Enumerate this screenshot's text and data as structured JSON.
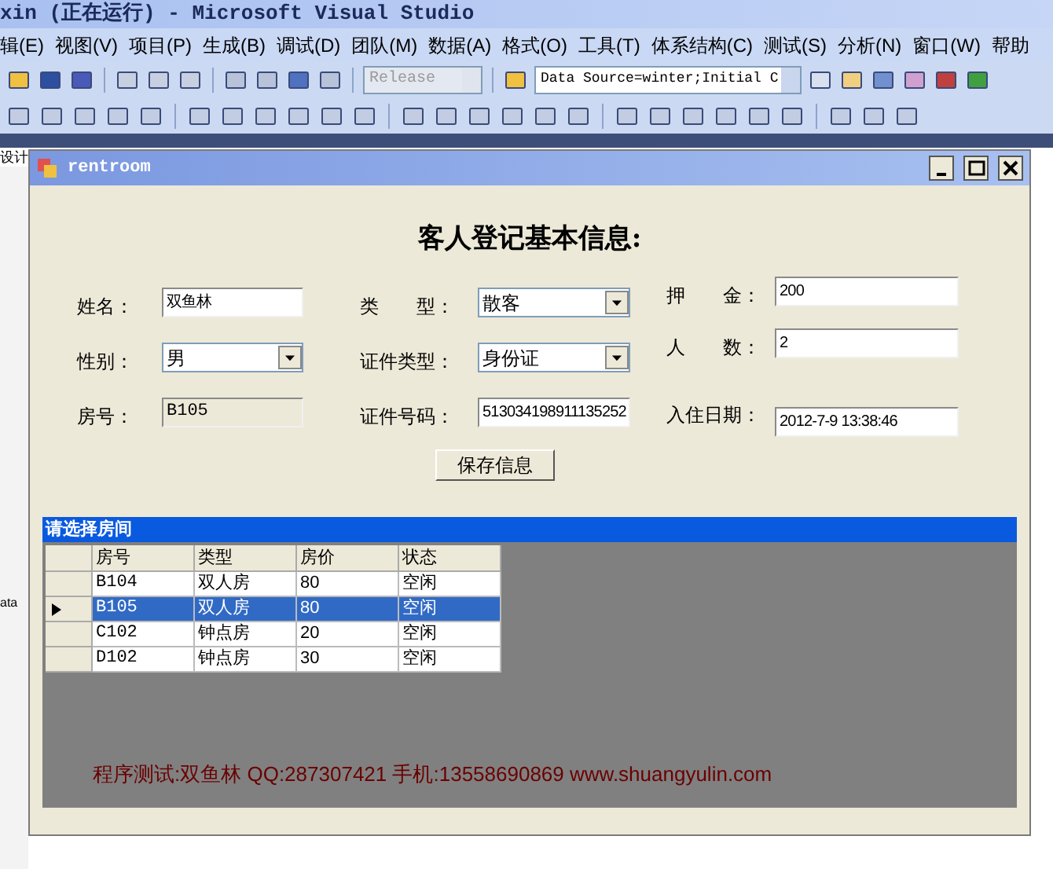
{
  "ide": {
    "title": "xin (正在运行) - Microsoft Visual Studio",
    "menu": [
      "辑(E)",
      "视图(V)",
      "项目(P)",
      "生成(B)",
      "调试(D)",
      "团队(M)",
      "数据(A)",
      "格式(O)",
      "工具(T)",
      "体系结构(C)",
      "测试(S)",
      "分析(N)",
      "窗口(W)",
      "帮助"
    ],
    "config_combo": {
      "value": "Release",
      "disabled": true
    },
    "connection_combo": {
      "value": "Data Source=winter;Initial C"
    },
    "designer_tab": "设计",
    "side_text": "ata"
  },
  "window": {
    "title": "rentroom",
    "heading": "客人登记基本信息:",
    "field_columns": [
      [
        {
          "label": "姓名：",
          "value": "双鱼林",
          "kind": "text"
        },
        {
          "label": "性别：",
          "value": "男",
          "kind": "combo"
        },
        {
          "label": "房号：",
          "value": "B105",
          "kind": "readonly"
        }
      ],
      [
        {
          "label": "类　　型：",
          "value": "散客",
          "kind": "combo"
        },
        {
          "label": "证件类型：",
          "value": "身份证",
          "kind": "combo"
        },
        {
          "label": "证件号码：",
          "value": "513034198911135252",
          "kind": "text"
        }
      ],
      [
        {
          "label": "押　　金：",
          "value": "200",
          "kind": "text"
        },
        {
          "label": "人　　数：",
          "value": "2",
          "kind": "text"
        },
        {
          "label": "入住日期：",
          "value": "2012-7-9 13:38:46",
          "kind": "text"
        }
      ]
    ],
    "save_button": "保存信息",
    "group": {
      "title": "请选择房间",
      "columns": [
        "房号",
        "类型",
        "房价",
        "状态"
      ],
      "rows": [
        {
          "cells": [
            "B104",
            "双人房",
            "80",
            "空闲"
          ],
          "selected": false
        },
        {
          "cells": [
            "B105",
            "双人房",
            "80",
            "空闲"
          ],
          "selected": true
        },
        {
          "cells": [
            "C102",
            "钟点房",
            "20",
            "空闲"
          ],
          "selected": false
        },
        {
          "cells": [
            "D102",
            "钟点房",
            "30",
            "空闲"
          ],
          "selected": false
        }
      ]
    },
    "footer_text": "程序测试:双鱼林 QQ:287307421 手机:13558690869 www.shuangyulin.com"
  }
}
